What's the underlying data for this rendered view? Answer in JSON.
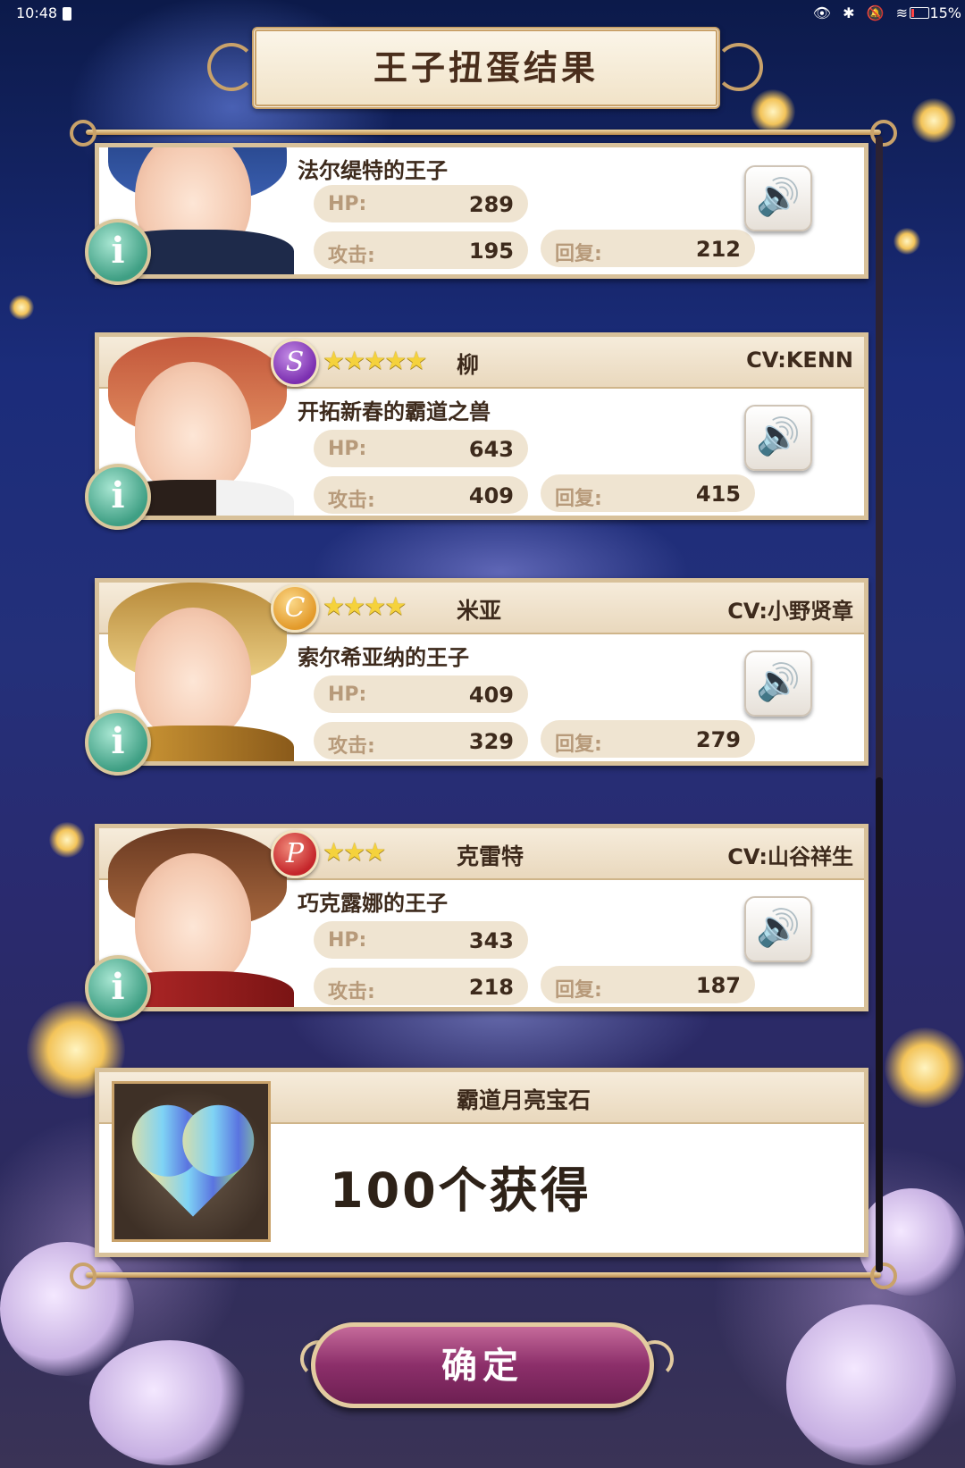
{
  "status_bar": {
    "time": "10:48",
    "icons": "👁 ✱ 🔕 ≋",
    "battery": "15%"
  },
  "header": {
    "title": "王子扭蛋结果"
  },
  "cards": [
    {
      "subtitle": "法尔缇特的王子",
      "hp_label": "HP:",
      "hp": "289",
      "atk_label": "攻击:",
      "atk": "195",
      "heal_label": "回复:",
      "heal": "212"
    },
    {
      "rarity": "S",
      "rarity_color": "#7b2fb0",
      "stars": "★★★★★",
      "name": "柳",
      "cv": "CV:KENN",
      "subtitle": "开拓新春的霸道之兽",
      "hp_label": "HP:",
      "hp": "643",
      "atk_label": "攻击:",
      "atk": "409",
      "heal_label": "回复:",
      "heal": "415"
    },
    {
      "rarity": "C",
      "rarity_color": "#e39a2a",
      "stars": "★★★★",
      "name": "米亚",
      "cv": "CV:小野贤章",
      "subtitle": "索尔希亚纳的王子",
      "hp_label": "HP:",
      "hp": "409",
      "atk_label": "攻击:",
      "atk": "329",
      "heal_label": "回复:",
      "heal": "279"
    },
    {
      "rarity": "P",
      "rarity_color": "#c4252a",
      "stars": "★★★",
      "name": "克雷特",
      "cv": "CV:山谷祥生",
      "subtitle": "巧克露娜的王子",
      "hp_label": "HP:",
      "hp": "343",
      "atk_label": "攻击:",
      "atk": "218",
      "heal_label": "回复:",
      "heal": "187"
    }
  ],
  "item": {
    "name": "霸道月亮宝石",
    "amount": "100个获得"
  },
  "buttons": {
    "confirm": "确定",
    "info_icon": "i",
    "voice_icon": "🔊"
  },
  "colors": {
    "frame_gold": "#d8c19a",
    "pill_bg": "#efe4d1",
    "confirm_purple": "#8c2f6a"
  }
}
